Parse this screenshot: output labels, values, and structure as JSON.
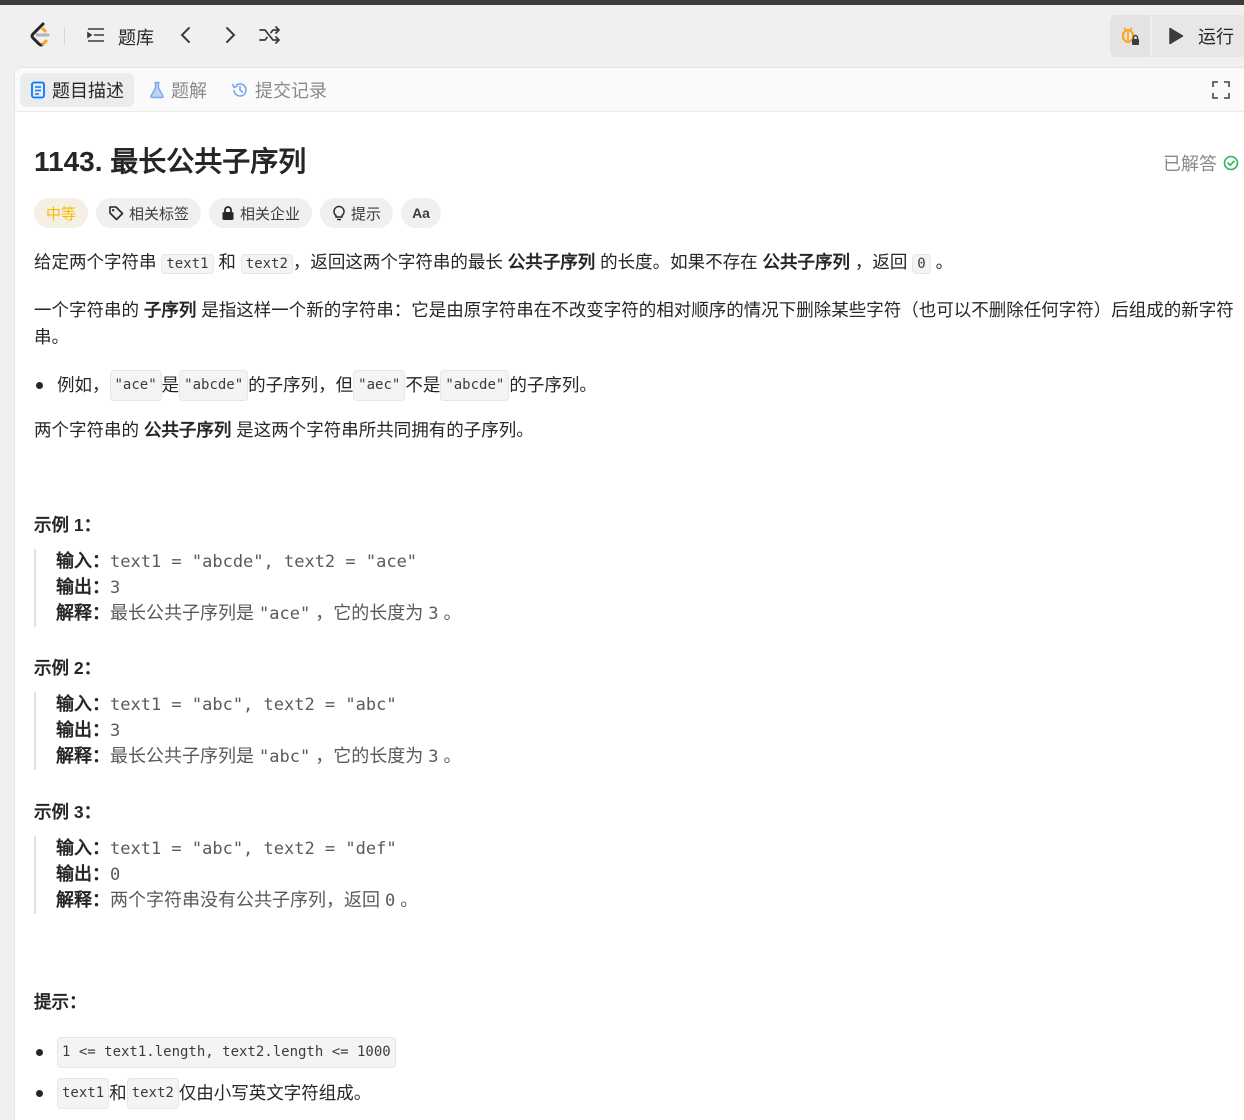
{
  "navbar": {
    "problem_list_label": "题库",
    "run_label": "运行"
  },
  "tabs": [
    {
      "label": "题目描述",
      "active": true
    },
    {
      "label": "题解",
      "active": false
    },
    {
      "label": "提交记录",
      "active": false
    }
  ],
  "problem": {
    "title": "1143. 最长公共子序列",
    "status": "已解答",
    "difficulty": "中等",
    "tags": [
      "相关标签",
      "相关企业",
      "提示"
    ],
    "translate_glyph": "Aa"
  },
  "description": {
    "p1": {
      "a": "给定两个字符串 ",
      "c1": "text1",
      "b": " 和 ",
      "c2": "text2",
      "d": "，返回这两个字符串的最长 ",
      "bold1": "公共子序列",
      "e": " 的长度。如果不存在 ",
      "bold2": "公共子序列",
      "f": " ，返回 ",
      "c3": "0",
      "g": " 。"
    },
    "p2": {
      "a": "一个字符串的 ",
      "bold": "子序列",
      "b": " 是指这样一个新的字符串：它是由原字符串在不改变字符的相对顺序的情况下删除某些字符（也可以不删除任何字符）后组成的新字符串。"
    },
    "bullet": {
      "a": "例如，",
      "c1": "\"ace\"",
      "b": " 是 ",
      "c2": "\"abcde\"",
      "c": " 的子序列，但 ",
      "c3": "\"aec\"",
      "d": " 不是 ",
      "c4": "\"abcde\"",
      "e": " 的子序列。"
    },
    "p3": {
      "a": "两个字符串的 ",
      "bold": "公共子序列",
      "b": " 是这两个字符串所共同拥有的子序列。"
    }
  },
  "examples": [
    {
      "heading": "示例 1：",
      "input_label": "输入：",
      "input": "text1 = \"abcde\", text2 = \"ace\"",
      "output_label": "输出：",
      "output": "3",
      "explain_label": "解释：",
      "explain_a": "最长公共子序列是 ",
      "explain_code": "\"ace\"",
      "explain_b": " ，它的长度为 ",
      "explain_num": "3",
      "explain_c": " 。"
    },
    {
      "heading": "示例 2：",
      "input_label": "输入：",
      "input": "text1 = \"abc\", text2 = \"abc\"",
      "output_label": "输出：",
      "output": "3",
      "explain_label": "解释：",
      "explain_a": "最长公共子序列是 ",
      "explain_code": "\"abc\"",
      "explain_b": " ，它的长度为 ",
      "explain_num": "3",
      "explain_c": " 。"
    },
    {
      "heading": "示例 3：",
      "input_label": "输入：",
      "input": "text1 = \"abc\", text2 = \"def\"",
      "output_label": "输出：",
      "output": "0",
      "explain_label": "解释：",
      "explain_a": "两个字符串没有公共子序列，返回 ",
      "explain_num": "0",
      "explain_c": " 。"
    }
  ],
  "constraints": {
    "heading": "提示：",
    "c1": "1 <= text1.length, text2.length <= 1000",
    "c2a": "text1",
    "c2b": " 和 ",
    "c2c": "text2",
    "c2d": " 仅由小写英文字符组成。"
  },
  "colors": {
    "accent_orange": "#ffb800",
    "solved_green": "#2db55d",
    "tab_icon_blue": "#007aff"
  }
}
